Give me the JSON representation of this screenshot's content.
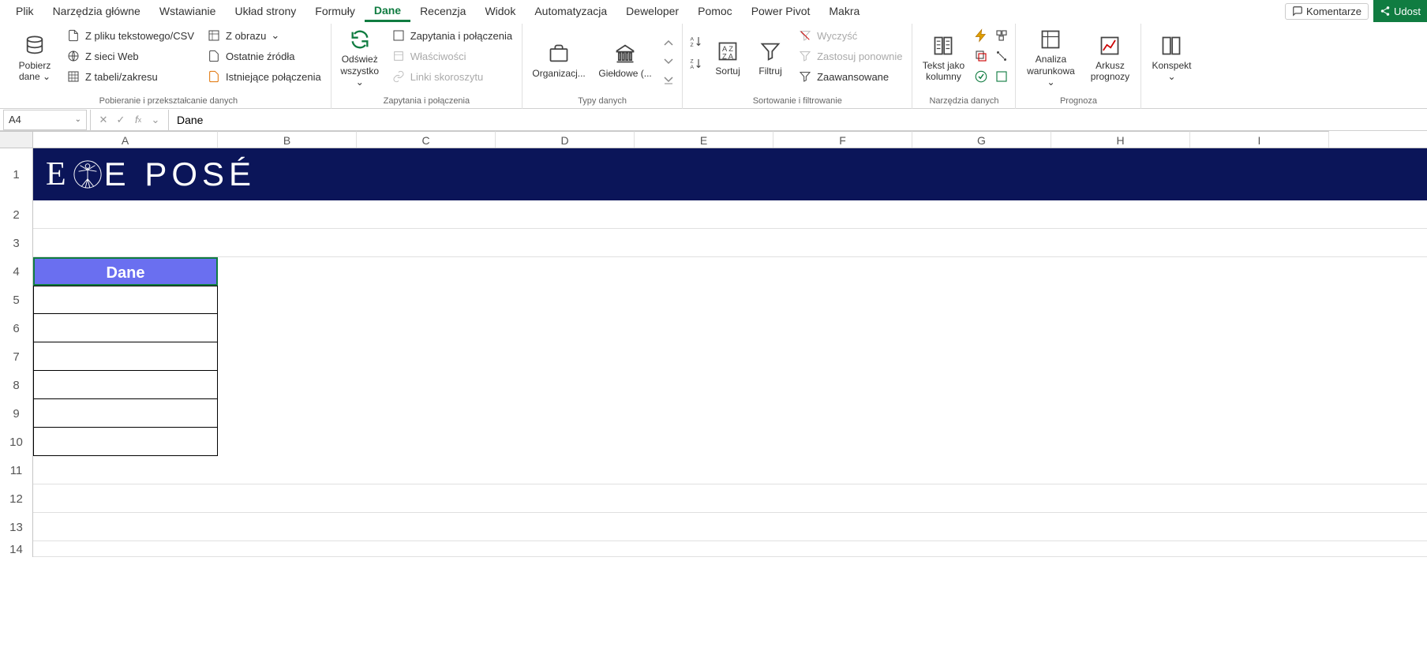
{
  "menu": {
    "tabs": [
      "Plik",
      "Narzędzia główne",
      "Wstawianie",
      "Układ strony",
      "Formuły",
      "Dane",
      "Recenzja",
      "Widok",
      "Automatyzacja",
      "Deweloper",
      "Pomoc",
      "Power Pivot",
      "Makra"
    ],
    "active": "Dane",
    "comments": "Komentarze",
    "share": "Udost"
  },
  "ribbon": {
    "group1": {
      "label": "Pobieranie i przekształcanie danych",
      "get_data": "Pobierz dane",
      "from_csv": "Z pliku tekstowego/CSV",
      "from_web": "Z sieci Web",
      "from_table": "Z tabeli/zakresu",
      "from_image": "Z obrazu",
      "recent": "Ostatnie źródła",
      "existing": "Istniejące połączenia"
    },
    "group2": {
      "label": "Zapytania i połączenia",
      "refresh": "Odśwież wszystko",
      "queries": "Zapytania i połączenia",
      "properties": "Właściwości",
      "links": "Linki skoroszytu"
    },
    "group3": {
      "label": "Typy danych",
      "org": "Organizacj...",
      "stocks": "Giełdowe (..."
    },
    "group4": {
      "label": "Sortowanie i filtrowanie",
      "sort": "Sortuj",
      "filter": "Filtruj",
      "clear": "Wyczyść",
      "reapply": "Zastosuj ponownie",
      "advanced": "Zaawansowane"
    },
    "group5": {
      "label": "Narzędzia danych",
      "text_cols": "Tekst jako kolumny"
    },
    "group6": {
      "label": "Prognoza",
      "whatif": "Analiza warunkowa",
      "forecast": "Arkusz prognozy"
    },
    "group7": {
      "outline": "Konspekt"
    }
  },
  "formula_bar": {
    "name_box": "A4",
    "formula": "Dane"
  },
  "grid": {
    "columns": [
      "A",
      "B",
      "C",
      "D",
      "E",
      "F",
      "G",
      "H",
      "I"
    ],
    "rows": [
      "1",
      "2",
      "3",
      "4",
      "5",
      "6",
      "7",
      "8",
      "9",
      "10",
      "11",
      "12",
      "13",
      "14"
    ],
    "banner_text": "E POSÉ",
    "header_cell": "Dane"
  }
}
